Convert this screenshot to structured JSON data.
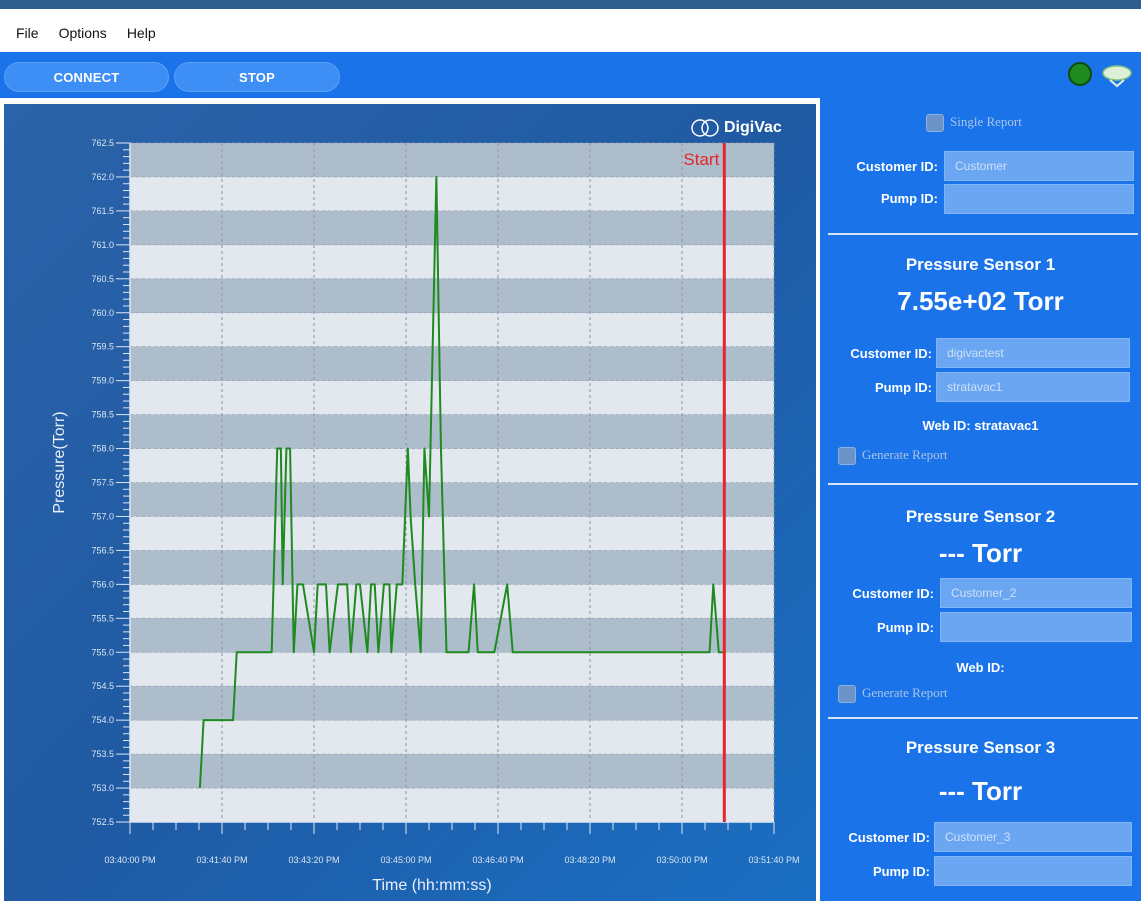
{
  "menu": {
    "file": "File",
    "options": "Options",
    "help": "Help"
  },
  "toolbar": {
    "connect_label": "CONNECT",
    "stop_label": "STOP"
  },
  "logo_text": "DigiVac",
  "chart_data": {
    "type": "line",
    "title": "",
    "xlabel": "Time (hh:mm:ss)",
    "ylabel": "Pressure(Torr)",
    "ylim": [
      752.5,
      762.5
    ],
    "yticks": [
      "762.5",
      "762.0",
      "761.5",
      "761.0",
      "760.5",
      "760.0",
      "759.5",
      "759.0",
      "758.5",
      "758.0",
      "757.5",
      "757.0",
      "756.5",
      "756.0",
      "755.5",
      "755.0",
      "754.5",
      "754.0",
      "753.5",
      "753.0",
      "752.5"
    ],
    "xticks": [
      "03:40:00 PM",
      "03:41:40 PM",
      "03:43:20 PM",
      "03:45:00 PM",
      "03:46:40 PM",
      "03:48:20 PM",
      "03:50:00 PM",
      "03:51:40 PM"
    ],
    "xlim_seconds_from_start": [
      0,
      700
    ],
    "marker_label": "Start",
    "marker_x": 646,
    "series": [
      {
        "color": "#1f8a1f",
        "x": [
          76,
          80,
          80,
          112,
          116,
          118,
          154,
          160,
          164,
          166,
          170,
          174,
          178,
          182,
          185,
          188,
          200,
          204,
          210,
          213,
          217,
          226,
          232,
          236,
          240,
          246,
          250,
          258,
          262,
          266,
          270,
          276,
          282,
          284,
          290,
          296,
          302,
          305,
          310,
          316,
          320,
          325,
          333,
          338,
          344,
          350,
          368,
          374,
          378,
          384,
          396,
          410,
          416,
          426,
          434,
          626,
          630,
          634,
          640,
          646
        ],
        "y": [
          753,
          754,
          754,
          754,
          755,
          755,
          755,
          758,
          758,
          756,
          758,
          758,
          755,
          756,
          756,
          756,
          755,
          756,
          756,
          756,
          755,
          756,
          756,
          756,
          755,
          756,
          756,
          755,
          756,
          756,
          755,
          756,
          756,
          755,
          756,
          756,
          758,
          757,
          756,
          755,
          758,
          757,
          762,
          758,
          755,
          755,
          755,
          756,
          755,
          755,
          755,
          756,
          755,
          755,
          755,
          755,
          755,
          756,
          755,
          755
        ]
      }
    ]
  },
  "sidebar": {
    "single_report": "Single Report",
    "customer_id_label": "Customer ID:",
    "customer_id_placeholder": "Customer",
    "pump_id_label": "Pump ID:",
    "sensor1": {
      "title": "Pressure Sensor 1",
      "reading": "7.55e+02 Torr",
      "customer_label": "Customer ID:",
      "customer_value": "digivactest",
      "pump_label": "Pump ID:",
      "pump_value": "stratavac1",
      "web_id": "Web ID: stratavac1",
      "generate": "Generate Report"
    },
    "sensor2": {
      "title": "Pressure Sensor 2",
      "reading": "--- Torr",
      "customer_label": "Customer ID:",
      "customer_placeholder": "Customer_2",
      "pump_label": "Pump ID:",
      "web_id": "Web ID:",
      "generate": "Generate Report"
    },
    "sensor3": {
      "title": "Pressure Sensor 3",
      "reading": "--- Torr",
      "customer_label": "Customer ID:",
      "customer_placeholder": "Customer_3",
      "pump_label": "Pump ID:"
    }
  }
}
